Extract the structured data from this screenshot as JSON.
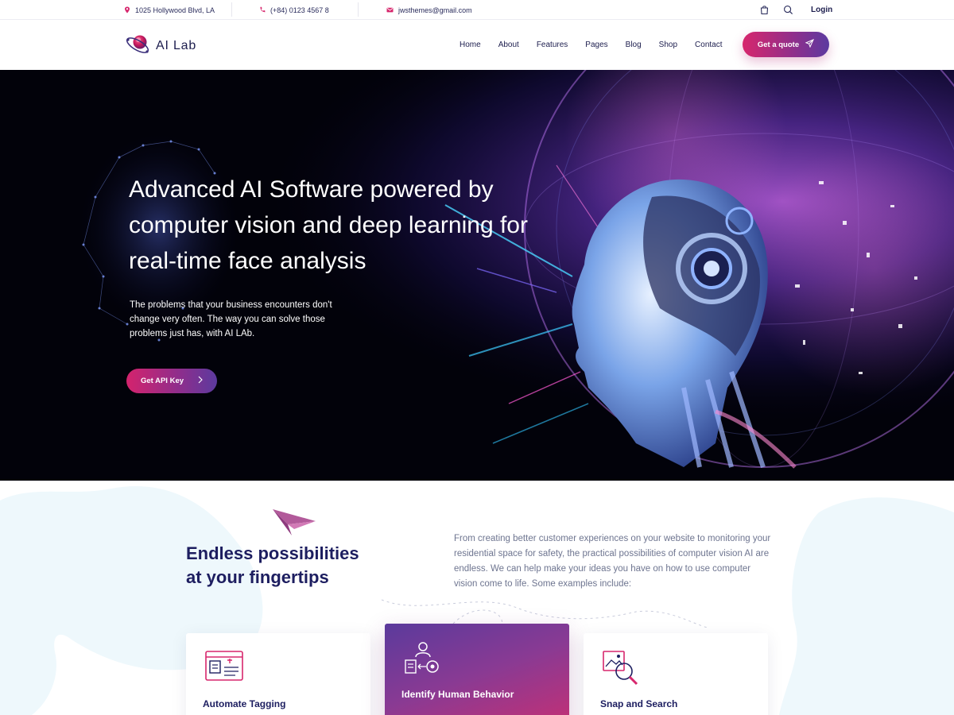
{
  "topbar": {
    "address": "1025 Hollywood Blvd, LA",
    "phone": "(+84) 0123 4567 8",
    "email": "jwsthemes@gmail.com",
    "login": "Login"
  },
  "header": {
    "logo_text": "AI Lab",
    "nav": [
      "Home",
      "About",
      "Features",
      "Pages",
      "Blog",
      "Shop",
      "Contact"
    ],
    "cta": "Get a quote"
  },
  "hero": {
    "title": "Advanced AI Software powered by computer vision and deep learning for real-time face analysis",
    "subtitle": "The problems that your business encounters don't change very often. The way you can solve those problems just has, with AI LAb.",
    "button": "Get API Key"
  },
  "features": {
    "heading_line1": "Endless possibilities",
    "heading_line2": "at your fingertips",
    "description": "From creating better customer experiences on your website to monitoring your residential space for safety, the practical possibilities of computer vision AI are endless. We can help make your ideas you have on how to use computer vision come to life. Some examples include:",
    "cards": [
      {
        "title": "Automate Tagging",
        "icon": "tagging-icon"
      },
      {
        "title": "Identify Human Behavior",
        "icon": "human-behavior-icon"
      },
      {
        "title": "Snap and Search",
        "icon": "snap-search-icon"
      }
    ]
  },
  "colors": {
    "navy": "#1d1e4e",
    "accent_pink": "#d7276d",
    "accent_purple": "#5b3aa0"
  }
}
